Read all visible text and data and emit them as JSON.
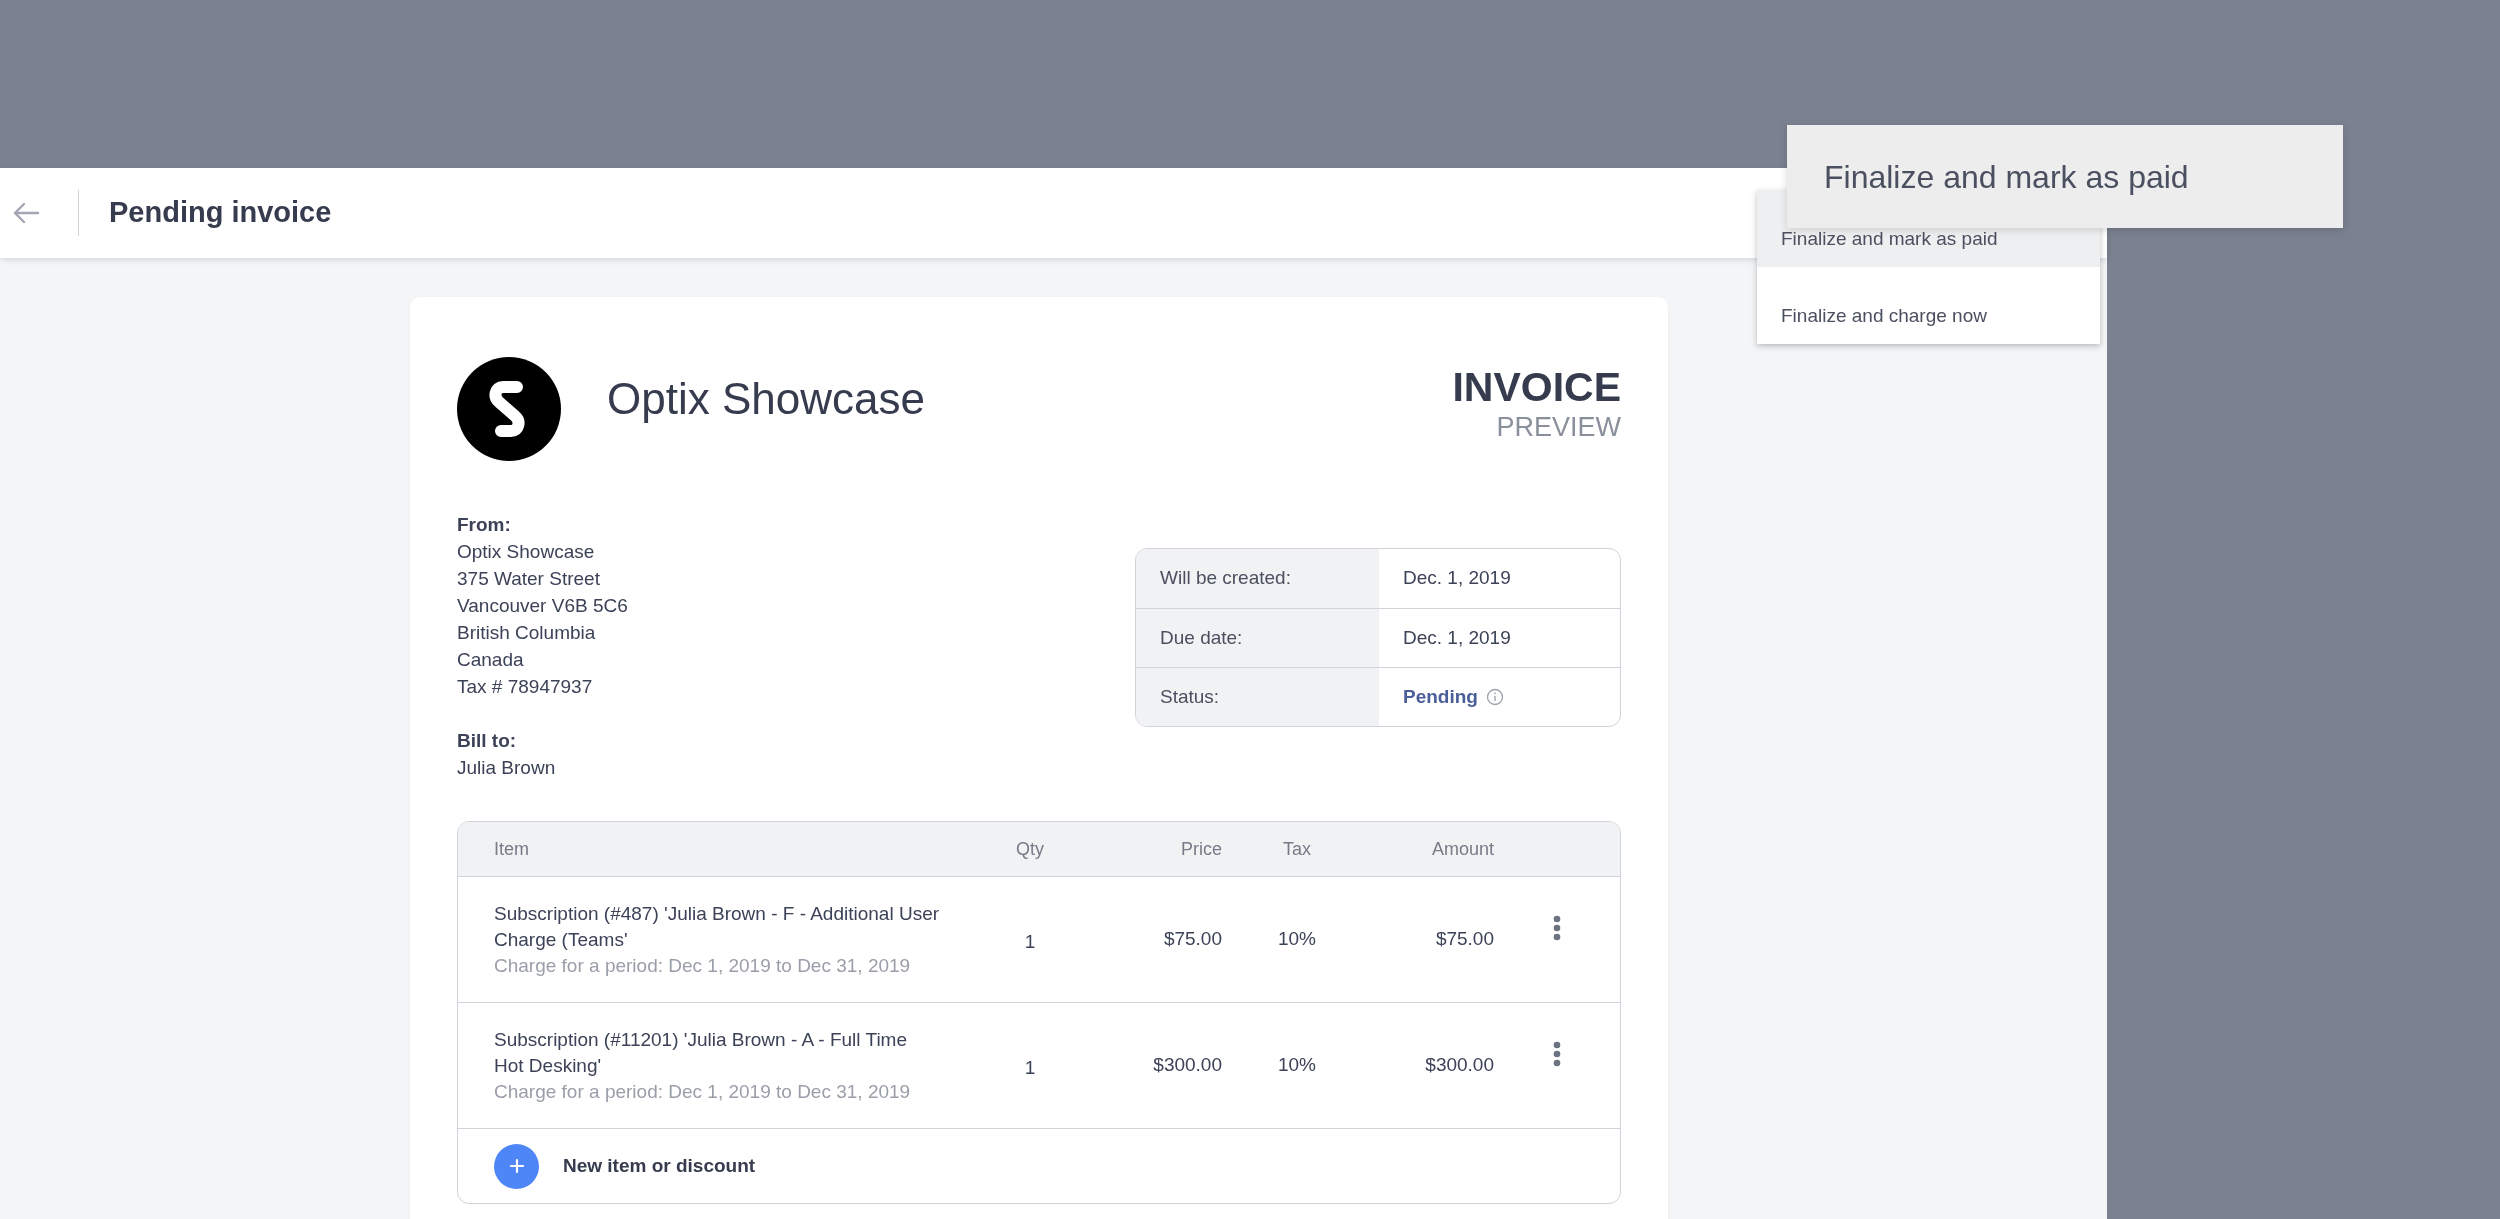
{
  "header": {
    "title": "Pending invoice"
  },
  "menu": {
    "items": [
      {
        "label": "Finalize and mark as paid",
        "selected": true
      },
      {
        "label": "Finalize and charge now",
        "selected": false
      }
    ]
  },
  "tooltip": {
    "text": "Finalize and mark as paid"
  },
  "invoice": {
    "company": "Optix Showcase",
    "title": "INVOICE",
    "subtitle": "PREVIEW",
    "from": {
      "label": "From:",
      "lines": [
        "Optix Showcase",
        "375 Water Street",
        "Vancouver V6B 5C6",
        "British Columbia",
        "Canada",
        "Tax # 78947937"
      ]
    },
    "bill_to": {
      "label": "Bill to:",
      "lines": [
        "Julia Brown"
      ]
    },
    "details": [
      {
        "label": "Will be created:",
        "value": "Dec. 1, 2019",
        "kind": "text"
      },
      {
        "label": "Due date:",
        "value": "Dec. 1, 2019",
        "kind": "text"
      },
      {
        "label": "Status:",
        "value": "Pending",
        "kind": "status"
      }
    ],
    "table": {
      "columns": [
        "Item",
        "Qty",
        "Price",
        "Tax",
        "Amount"
      ],
      "rows": [
        {
          "item": "Subscription (#487) 'Julia Brown - F - Additional User Charge (Teams'",
          "description": "Charge for a period: Dec 1, 2019 to Dec 31, 2019",
          "qty": "1",
          "price": "$75.00",
          "tax": "10%",
          "amount": "$75.00"
        },
        {
          "item": "Subscription (#11201) 'Julia Brown - A - Full Time Hot Desking'",
          "description": "Charge for a period: Dec 1, 2019 to Dec 31, 2019",
          "qty": "1",
          "price": "$300.00",
          "tax": "10%",
          "amount": "$300.00"
        }
      ]
    },
    "add_item": {
      "label": "New item or discount"
    }
  }
}
